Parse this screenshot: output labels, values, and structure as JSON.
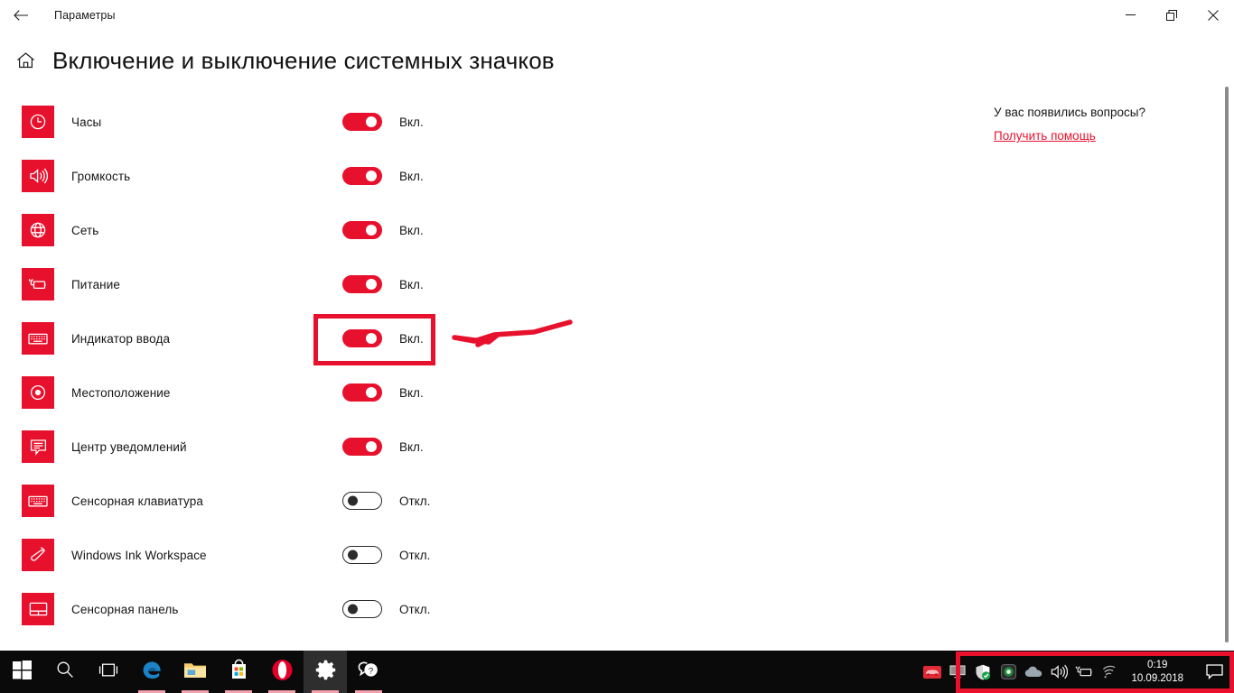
{
  "window": {
    "title": "Параметры",
    "back_icon": "back-arrow-icon",
    "minimize_icon": "minimize-icon",
    "restore_icon": "restore-icon",
    "close_icon": "close-icon"
  },
  "page": {
    "home_icon": "home-icon",
    "title": "Включение и выключение системных значков"
  },
  "colors": {
    "accent_red": "#e8112d",
    "text": "#151515",
    "taskbar_bg": "#0a0a0a",
    "annotation": "#e8112d"
  },
  "items": [
    {
      "icon": "clock-icon",
      "label": "Часы",
      "state": "Вкл.",
      "on": true,
      "highlighted": false
    },
    {
      "icon": "volume-icon",
      "label": "Громкость",
      "state": "Вкл.",
      "on": true,
      "highlighted": false
    },
    {
      "icon": "network-icon",
      "label": "Сеть",
      "state": "Вкл.",
      "on": true,
      "highlighted": false
    },
    {
      "icon": "power-icon",
      "label": "Питание",
      "state": "Вкл.",
      "on": true,
      "highlighted": false
    },
    {
      "icon": "keyboard-icon",
      "label": "Индикатор ввода",
      "state": "Вкл.",
      "on": true,
      "highlighted": true
    },
    {
      "icon": "location-icon",
      "label": "Местоположение",
      "state": "Вкл.",
      "on": true,
      "highlighted": false
    },
    {
      "icon": "action-center-icon",
      "label": "Центр уведомлений",
      "state": "Вкл.",
      "on": true,
      "highlighted": false
    },
    {
      "icon": "touch-keyboard-icon",
      "label": "Сенсорная клавиатура",
      "state": "Откл.",
      "on": false,
      "highlighted": false
    },
    {
      "icon": "pen-icon",
      "label": "Windows Ink Workspace",
      "state": "Откл.",
      "on": false,
      "highlighted": false
    },
    {
      "icon": "touchpad-icon",
      "label": "Сенсорная панель",
      "state": "Откл.",
      "on": false,
      "highlighted": false
    }
  ],
  "help": {
    "question": "У вас появились вопросы?",
    "link": "Получить помощь"
  },
  "taskbar": {
    "buttons": [
      {
        "name": "start-button",
        "icon": "windows-logo-icon",
        "active": false,
        "running": false
      },
      {
        "name": "search-button",
        "icon": "search-icon",
        "active": false,
        "running": false
      },
      {
        "name": "task-view-button",
        "icon": "task-view-icon",
        "active": false,
        "running": false
      },
      {
        "name": "edge-button",
        "icon": "edge-icon",
        "active": false,
        "running": true
      },
      {
        "name": "explorer-button",
        "icon": "folder-icon",
        "active": false,
        "running": true
      },
      {
        "name": "store-button",
        "icon": "store-icon",
        "active": false,
        "running": true
      },
      {
        "name": "opera-button",
        "icon": "opera-icon",
        "active": false,
        "running": true
      },
      {
        "name": "settings-button",
        "icon": "gear-icon",
        "active": true,
        "running": true
      },
      {
        "name": "help-app-button",
        "icon": "help-chat-icon",
        "active": false,
        "running": true
      }
    ],
    "tray_icons": [
      "red-car-app-icon",
      "display-monitor-icon",
      "defender-shield-icon",
      "webcam-icon",
      "onedrive-cloud-icon",
      "volume-icon",
      "battery-icon",
      "wifi-icon"
    ],
    "clock": {
      "time": "0:19",
      "date": "10.09.2018"
    },
    "show_desktop_icon": "action-center-icon"
  }
}
